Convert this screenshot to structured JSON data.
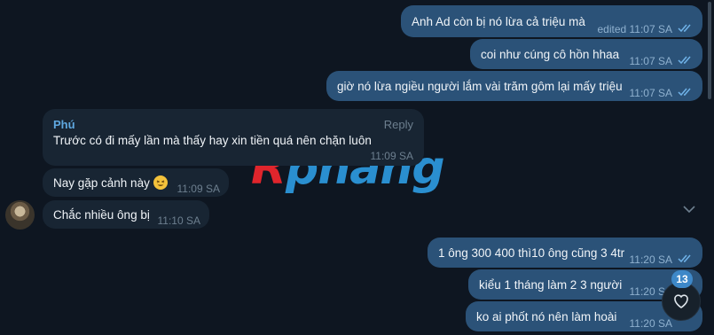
{
  "watermark": {
    "first": "R",
    "rest": "phang"
  },
  "messages": [
    {
      "text": "Anh Ad còn bị nó lừa cả triệu mà",
      "time": "edited 11:07 SA"
    },
    {
      "text": "coi như cúng cô hồn hhaa",
      "time": "11:07 SA"
    },
    {
      "text": "giờ nó lừa ngiều người lắm vài trăm gôm lại mấy triệu",
      "time": "11:07 SA"
    },
    {
      "sender": "Phú",
      "reply": "Reply",
      "text": "Trước có đi mấy lần mà thấy hay xin tiền quá nên chặn luôn",
      "time": "11:09 SA"
    },
    {
      "text": "Nay gặp cảnh này",
      "time": "11:09 SA"
    },
    {
      "text": "Chắc nhiều ông bị",
      "time": "11:10 SA"
    },
    {
      "text": "1 ông 300 400 thì10 ông cũng 3 4tr",
      "time": "11:20 SA"
    },
    {
      "text": "kiểu 1 tháng làm 2 3 người",
      "time": "11:20 SA"
    },
    {
      "text": "ko ai phốt nó nên làm hoài",
      "time": "11:20 SA"
    }
  ],
  "unread_count": "13",
  "icons": {
    "read": "double-check-icon",
    "emoji": "squint-laugh-emoji",
    "reaction": "heart-icon",
    "collapse": "chevron-down-icon"
  },
  "colors": {
    "background": "#0e1621",
    "outgoing": "#2b5278",
    "incoming": "#182533",
    "sender": "#5fa8e0",
    "badge": "#3e88c8"
  }
}
